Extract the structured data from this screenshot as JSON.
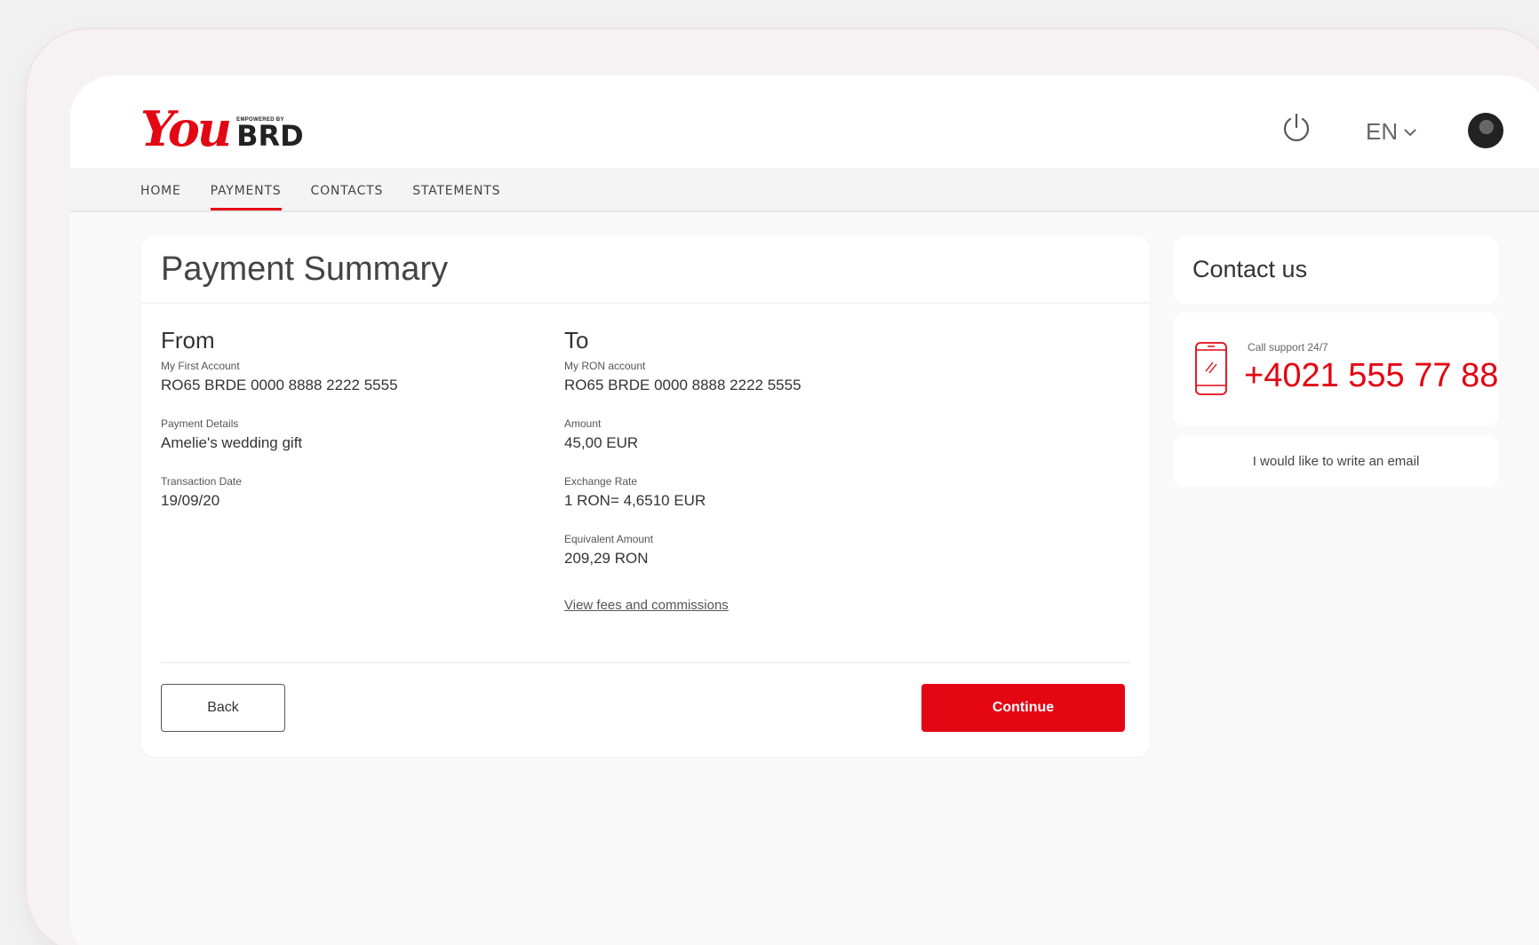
{
  "brand": {
    "logo_text": "You",
    "brd_small": "EMPOWERED BY",
    "brd_big": "BRD",
    "accent": "#e30613"
  },
  "header": {
    "power_icon": "power-icon",
    "language": "EN",
    "avatar": "avatar"
  },
  "nav": [
    {
      "label": "HOME",
      "active": false
    },
    {
      "label": "PAYMENTS",
      "active": true
    },
    {
      "label": "CONTACTS",
      "active": false
    },
    {
      "label": "STATEMENTS",
      "active": false
    }
  ],
  "summary": {
    "title": "Payment Summary",
    "from": {
      "heading": "From",
      "account_label": "My First Account",
      "account_value": "RO65 BRDE 0000 8888 2222 5555",
      "details_label": "Payment Details",
      "details_value": "Amelie's wedding gift",
      "date_label": "Transaction Date",
      "date_value": "19/09/20"
    },
    "to": {
      "heading": "To",
      "account_label": "My RON account",
      "account_value": "RO65 BRDE 0000 8888 2222 5555",
      "amount_label": "Amount",
      "amount_value": "45,00 EUR",
      "rate_label": "Exchange Rate",
      "rate_value": "1 RON= 4,6510 EUR",
      "equiv_label": "Equivalent Amount",
      "equiv_value": "209,29 RON",
      "fees_link": "View fees and commissions"
    },
    "back_label": "Back",
    "continue_label": "Continue"
  },
  "contact": {
    "title": "Contact us",
    "call_label": "Call support 24/7",
    "phone": "+4021 555 77 88",
    "email_link": "I would like to write an email"
  }
}
